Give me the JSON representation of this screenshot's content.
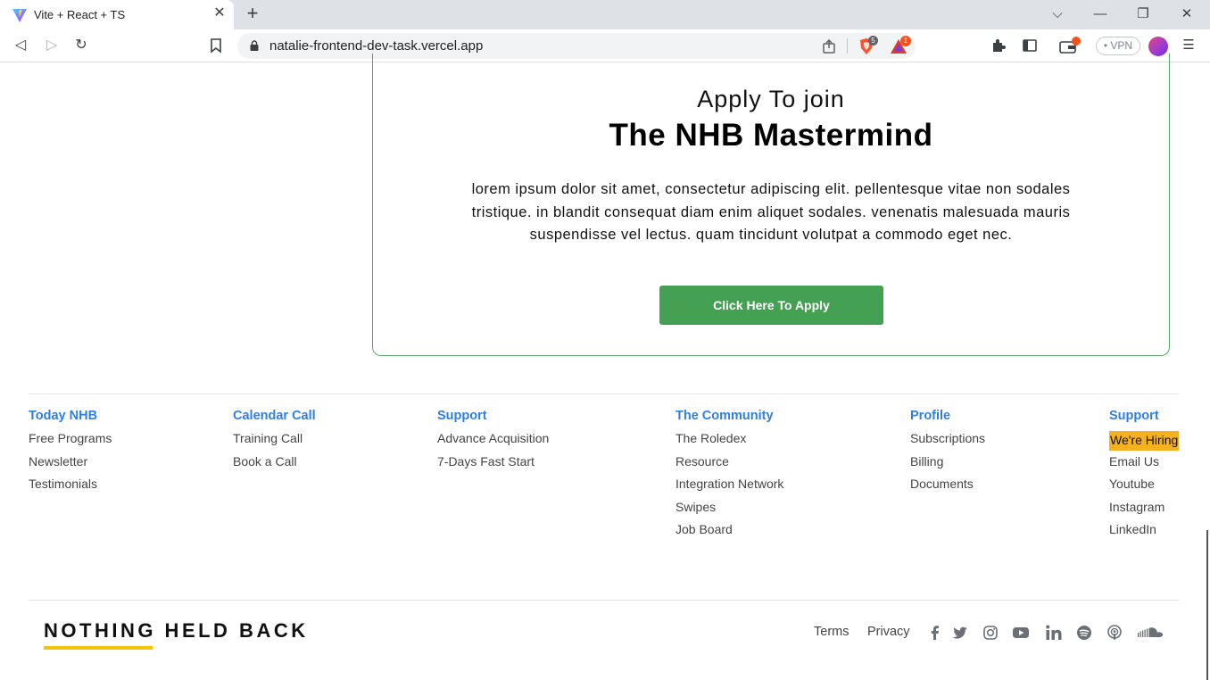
{
  "browser": {
    "tab_title": "Vite + React + TS",
    "url": "natalie-frontend-dev-task.vercel.app",
    "vpn_label": "• VPN",
    "brave_badge": "5",
    "rewards_badge": "1"
  },
  "apply": {
    "heading_small": "Apply To join",
    "heading_big": "The NHB Mastermind",
    "body": "lorem ipsum dolor sit amet, consectetur adipiscing elit. pellentesque vitae non sodales tristique. in blandit consequat diam enim aliquet sodales. venenatis malesuada mauris suspendisse vel lectus. quam tincidunt volutpat a commodo eget nec.",
    "button_label": "Click Here To Apply",
    "button_color": "#44a052"
  },
  "footer": {
    "columns": [
      {
        "heading": "Today NHB",
        "links": [
          "Free Programs",
          "Newsletter",
          "Testimonials"
        ]
      },
      {
        "heading": "Calendar Call",
        "links": [
          "Training Call",
          "Book a Call"
        ]
      },
      {
        "heading": "Support",
        "links": [
          "Advance Acquisition",
          "7-Days Fast Start"
        ]
      },
      {
        "heading": "The Community",
        "links": [
          "The Roledex",
          "Resource",
          "Integration Network",
          "Swipes",
          "Job Board"
        ]
      },
      {
        "heading": "Profile",
        "links": [
          "Subscriptions",
          "Billing",
          "Documents"
        ]
      },
      {
        "heading": "Support",
        "links": [
          "We're Hiring",
          "Email Us",
          "Youtube",
          "Instagram",
          "LinkedIn"
        ]
      }
    ],
    "highlight_color": "#f5b21e",
    "heading_color": "#2f7fe0",
    "brand": "NOTHING HELD BACK",
    "brand_accent": "#f5c400",
    "terms": "Terms",
    "privacy": "Privacy",
    "social_icons": [
      "facebook-icon",
      "twitter-icon",
      "instagram-icon",
      "youtube-icon",
      "linkedin-icon",
      "spotify-icon",
      "podcast-icon",
      "soundcloud-icon"
    ]
  }
}
